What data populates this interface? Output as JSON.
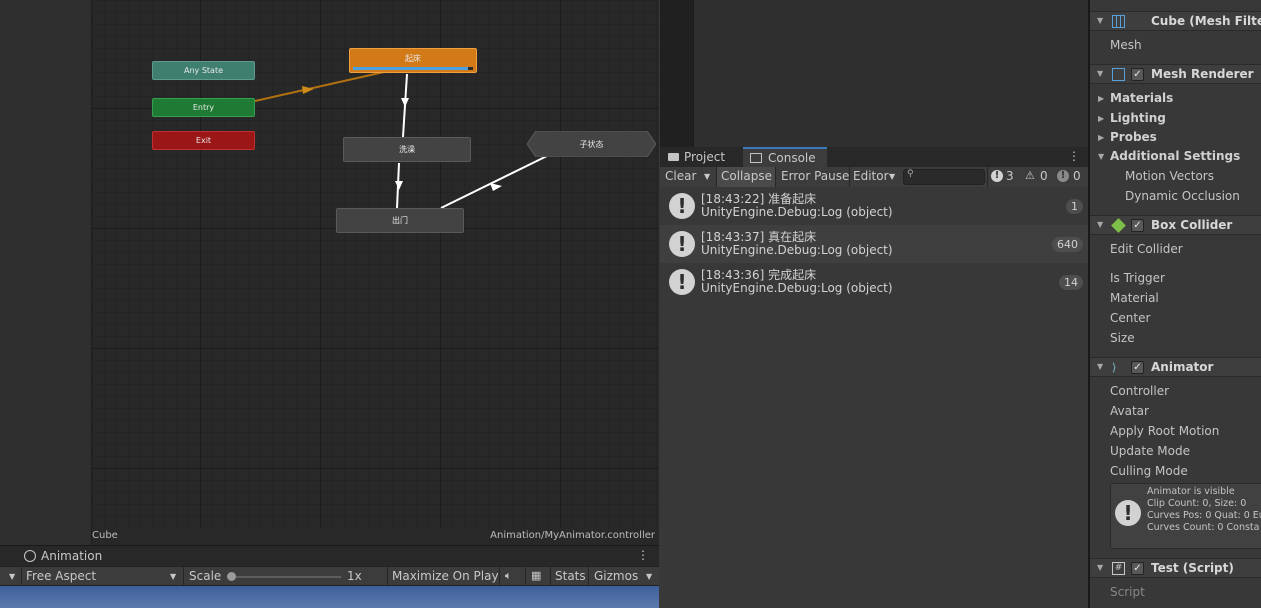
{
  "graph": {
    "nodes": {
      "any_state": "Any State",
      "entry": "Entry",
      "exit": "Exit",
      "qichuang": "起床",
      "xizao": "洗澡",
      "chumen": "出门",
      "substate": "子状态"
    },
    "footer_left": "Cube",
    "footer_right": "Animation/MyAnimator.controller",
    "colors": {
      "default_state": "#d27a18",
      "any_state": "#3f7f6f",
      "entry": "#1f7a33",
      "exit": "#9b1616",
      "state": "#434343",
      "progress": "#4aa0e0"
    },
    "progress": 0.96
  },
  "animation": {
    "tab_title": "Animation",
    "aspect": "Free Aspect",
    "scale_label": "Scale",
    "scale_value": "1x",
    "maximize": "Maximize On Play",
    "stats": "Stats",
    "gizmos": "Gizmos"
  },
  "console": {
    "tabs": {
      "project": "Project",
      "console": "Console"
    },
    "toolbar": {
      "clear": "Clear",
      "collapse": "Collapse",
      "error_pause": "Error Pause",
      "editor": "Editor",
      "search_placeholder": "",
      "log_count": "3",
      "warn_count": "0",
      "error_count": "0"
    },
    "logs": [
      {
        "line1": "[18:43:22] 准备起床",
        "line2": "UnityEngine.Debug:Log (object)",
        "count": "1"
      },
      {
        "line1": "[18:43:37] 真在起床",
        "line2": "UnityEngine.Debug:Log (object)",
        "count": "640"
      },
      {
        "line1": "[18:43:36] 完成起床",
        "line2": "UnityEngine.Debug:Log (object)",
        "count": "14"
      }
    ]
  },
  "inspector": {
    "mesh_filter": {
      "title": "Cube (Mesh Filter)",
      "mesh": "Mesh"
    },
    "mesh_renderer": {
      "title": "Mesh Renderer",
      "materials": "Materials",
      "lighting": "Lighting",
      "probes": "Probes",
      "additional": "Additional Settings",
      "motion_vectors": "Motion Vectors",
      "dynamic_occlusion": "Dynamic Occlusion"
    },
    "box_collider": {
      "title": "Box Collider",
      "edit": "Edit Collider",
      "is_trigger": "Is Trigger",
      "material": "Material",
      "center": "Center",
      "size": "Size"
    },
    "animator": {
      "title": "Animator",
      "controller": "Controller",
      "avatar": "Avatar",
      "apply_root_motion": "Apply Root Motion",
      "update_mode": "Update Mode",
      "culling_mode": "Culling Mode",
      "info": {
        "l1": "Animator is visible",
        "l2": "Clip Count: 0, Size: 0",
        "l3": "Curves Pos: 0 Quat: 0 Eu",
        "l4": "Curves Count: 0 Consta"
      }
    },
    "test_script": {
      "title": "Test (Script)",
      "script": "Script"
    }
  }
}
